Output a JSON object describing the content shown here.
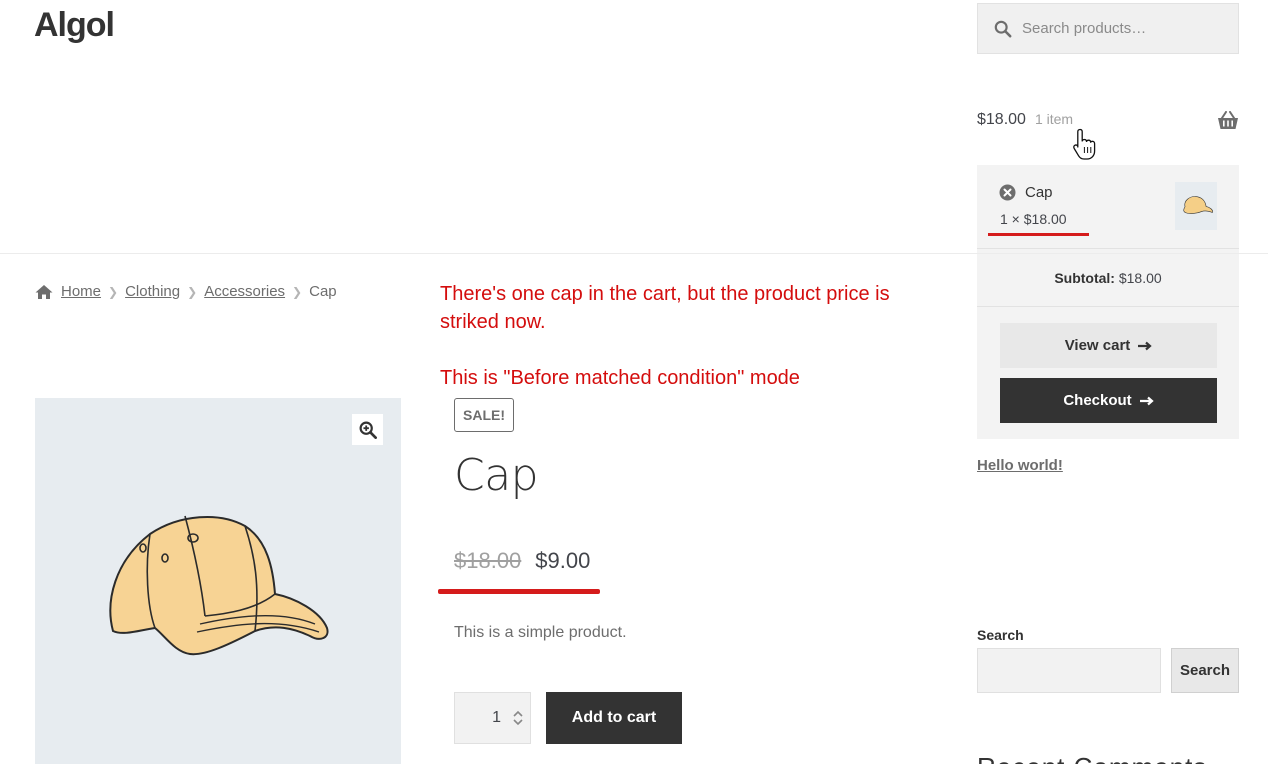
{
  "header": {
    "site_title": "Algol",
    "search_placeholder": "Search products…",
    "cart_total": "$18.00",
    "cart_count": "1 item"
  },
  "mini_cart": {
    "item_name": "Cap",
    "item_qty_price": "1 × $18.00",
    "subtotal_label": "Subtotal:",
    "subtotal_value": "$18.00",
    "view_cart_label": "View cart",
    "checkout_label": "Checkout"
  },
  "sidebar": {
    "hello_link": "Hello world!",
    "search_widget_title": "Search",
    "search_button_label": "Search",
    "recent_comments_heading": "Recent Comments"
  },
  "breadcrumb": {
    "items": [
      "Home",
      "Clothing",
      "Accessories"
    ],
    "current": "Cap"
  },
  "annotation": {
    "line1": "There's one cap in the cart, but the product price is striked now.",
    "line2": "This is \"Before matched condition\" mode"
  },
  "product": {
    "sale_badge": "SALE!",
    "title": "Cap",
    "old_price": "$18.00",
    "new_price": "$9.00",
    "short_description": "This is a simple product.",
    "quantity": "1",
    "add_to_cart_label": "Add to cart"
  },
  "colors": {
    "accent_red": "#d51b1b",
    "dark_button": "#333333",
    "annotation_red": "#d40d0d"
  }
}
